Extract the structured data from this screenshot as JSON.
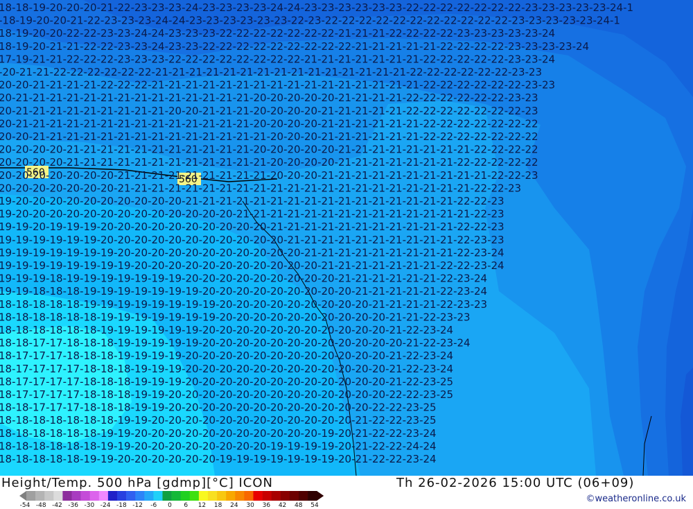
{
  "map": {
    "title": "Height/Temp. 500 hPa [gdmp][°C] ICON",
    "datetime": "Th 26-02-2026 15:00 UTC (06+09)",
    "credit": "©weatheronline.co.uk",
    "contour_labels": [
      "560",
      "560"
    ],
    "colors": {
      "minus17": "#2ef2ff",
      "minus18": "#1ad8ff",
      "minus19": "#12b8fa",
      "minus20": "#1aa6f4",
      "minus21": "#1894ee",
      "minus22": "#1680e8",
      "minus23": "#1670e2",
      "minus24": "#1464dc",
      "minus25": "#1458d6"
    },
    "rows": [
      "18-18-19-20-20-20-21-22-23-23-23-24-23-23-23-23-24-24-23-23-23-23-23-23-22-22-22-22-22-22-22-23-23-23-23-23-24-1",
      "-18-19-20-20-21-22-23-23-23-24-24-23-23-23-23-23-23-22-23-22-22-22-22-22-22-22-22-22-22-22-23-23-23-23-23-24-1",
      "18-19-20-20-22-22-23-23-24-24-23-23-23-22-22-22-22-22-22-22-21-21-21-22-22-22-22-23-23-23-23-23-24",
      "18-19-20-21-21-22-22-23-23-24-23-23-22-22-22-22-22-22-22-22-22-21-21-21-21-21-22-22-22-22-23-23-23-23-24",
      "17-19-21-21-22-22-22-23-23-23-22-22-22-22-22-22-22-22-21-21-21-21-21-21-21-22-22-22-22-22-23-23-24",
      "-20-21-21-22-22-22-22-22-22-21-21-21-21-21-21-21-21-21-21-21-21-21-21-21-22-22-22-22-22-22-23-23",
      "20-20-21-21-21-21-22-22-22-21-21-21-21-21-21-21-21-21-21-21-21-21-21-21-21-22-22-22-22-22-22-23-23",
      "20-21-21-21-21-21-21-21-21-21-21-21-21-21-21-20-20-20-20-20-21-21-21-21-22-22-22-22-22-22-23-23",
      "20-21-21-21-21-21-21-21-21-21-20-20-21-21-21-20-20-20-20-21-21-21-21-21-22-22-22-22-22-22-22-23",
      "20-21-21-21-21-21-21-21-21-21-21-21-21-21-21-20-20-20-20-21-21-21-21-21-21-22-22-22-22-22-22-22",
      "20-20-21-21-21-21-21-21-21-21-21-21-21-21-21-21-20-20-20-21-21-21-21-21-21-22-22-22-22-22-22-22",
      "20-20-20-20-21-21-21-21-21-21-21-21-21-21-21-20-20-20-20-20-21-21-21-21-21-21-21-21-22-22-22-22",
      "20-20-20-20-21-21-21-21-21-21-21-21-21-21-21-21-20-20-20-20-21-21-21-21-21-21-21-22-22-22-22-22",
      "20-20-20-20-20-20-20-21-21-21-21-21-21-21-21-21-20-20-20-21-21-21-21-21-21-21-21-21-21-22-22-23",
      "20-20-20-20-20-20-20-21-21-21-21-21-21-21-21-21-21-21-21-21-21-21-21-21-21-21-21-21-22-22-23",
      "19-20-20-20-20-20-20-20-20-20-20-21-21-21-21-21-21-21-21-21-21-21-21-21-21-21-21-22-22-23",
      "19-20-20-20-20-20-20-20-20-20-20-20-20-20-21-21-21-21-21-21-21-21-21-21-21-21-21-21-22-23",
      "19-19-20-19-19-19-20-20-20-20-20-20-20-20-20-20-21-21-21-21-21-21-21-21-21-21-21-22-22-23",
      "19-19-19-19-19-19-20-20-20-20-20-20-20-20-20-20-20-21-21-21-21-21-21-21-21-21-21-22-23-23",
      "19-19-19-19-19-19-19-20-20-20-20-20-20-20-20-20-20-20-21-21-21-21-21-21-21-21-21-22-23-24",
      "19-19-19-19-19-19-19-19-20-20-20-20-20-20-20-20-20-20-20-21-21-21-21-21-21-21-22-22-23-24",
      "19-19-19-18-19-19-19-19-19-19-19-20-20-20-20-20-20-20-20-20-21-21-21-21-21-21-22-23-24",
      "19-19-18-18-18-19-19-19-19-19-19-19-20-20-20-20-20-20-20-20-20-21-21-21-21-21-22-23-24",
      "18-18-18-18-18-19-19-19-19-19-19-19-19-20-20-20-20-20-20-20-20-20-21-21-21-21-22-23-23",
      "18-18-18-18-18-18-19-19-19-19-19-19-19-20-20-20-20-20-20-20-20-20-20-21-21-22-23-23",
      "18-18-18-18-18-18-19-19-19-19-19-19-20-20-20-20-20-20-20-20-20-20-20-21-22-23-24",
      "18-18-17-17-18-18-18-19-19-19-19-19-20-20-20-20-20-20-20-20-20-20-20-20-21-22-23-24",
      "18-17-17-17-18-18-18-19-19-19-19-20-20-20-20-20-20-20-20-20-20-20-20-21-22-23-24",
      "18-17-17-17-17-18-18-18-19-19-19-20-20-20-20-20-20-20-20-20-20-20-20-21-22-23-24",
      "18-17-17-17-17-18-18-18-19-19-19-20-20-20-20-20-20-20-20-20-20-20-20-21-22-23-25",
      "18-17-17-17-17-18-18-18-19-19-20-20-20-20-20-20-20-20-20-20-20-20-20-22-22-23-25",
      "18-18-17-17-17-18-18-18-19-19-20-20-20-20-20-20-20-20-20-20-20-20-22-22-23-25",
      "18-18-18-18-18-18-18-19-19-20-20-20-20-20-20-20-20-20-20-20-20-21-22-22-23-25",
      "18-18-18-18-18-18-19-19-20-20-20-20-20-20-20-20-20-20-20-19-20-21-22-22-23-24",
      "18-18-18-18-18-18-19-19-20-20-20-20-20-20-20-20-19-19-19-19-20-21-22-22-24-24",
      "18-18-18-18-18-19-19-20-20-20-20-20-20-19-19-19-19-19-19-19-20-21-22-22-23-24"
    ]
  },
  "legend": {
    "ticks": [
      "-54",
      "-48",
      "-42",
      "-36",
      "-30",
      "-24",
      "-18",
      "-12",
      "-6",
      "0",
      "6",
      "12",
      "18",
      "24",
      "30",
      "36",
      "42",
      "48",
      "54"
    ],
    "swatches": [
      "#a0a0a0",
      "#b4b4b4",
      "#c8c8c8",
      "#dcdcdc",
      "#8c2d9c",
      "#a83cc0",
      "#c44cd8",
      "#dc64ec",
      "#f088ff",
      "#2020c8",
      "#2840e0",
      "#3060f0",
      "#2c84f8",
      "#24a8f8",
      "#20d0f8",
      "#10a040",
      "#14b838",
      "#20d020",
      "#40e010",
      "#f8f820",
      "#f8e020",
      "#f8c810",
      "#f8a800",
      "#f88800",
      "#f86800",
      "#e80000",
      "#c80000",
      "#a80000",
      "#880000",
      "#6c0000",
      "#500000",
      "#300000"
    ]
  }
}
